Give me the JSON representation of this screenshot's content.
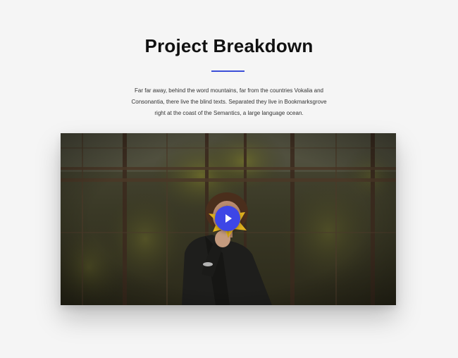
{
  "section": {
    "title": "Project Breakdown",
    "description_lines": [
      "Far far away, behind the word mountains, far from the countries Vokalia and",
      "Consonantia, there live the blind texts. Separated they live in Bookmarksgrove",
      "right at the coast of the Semantics, a large language ocean."
    ]
  },
  "video": {
    "play_icon": "play-icon"
  },
  "colors": {
    "accent": "#3b4fd8",
    "play_button": "#3d46e6",
    "background": "#f5f5f5",
    "title": "#111111"
  }
}
